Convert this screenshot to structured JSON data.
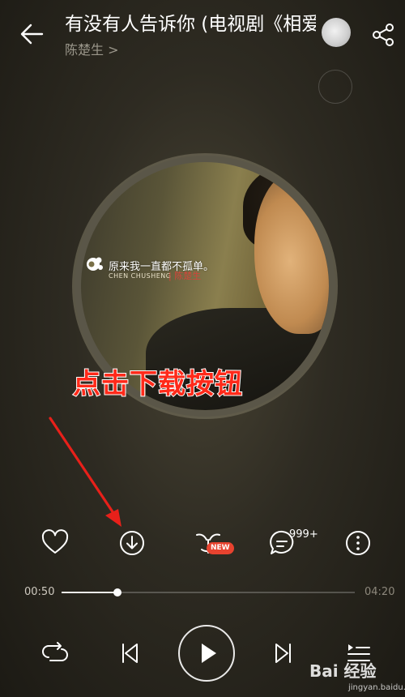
{
  "header": {
    "title": "有没有人告诉你 (电视剧《相爱",
    "artist": "陈楚生 >"
  },
  "cover": {
    "slogan": "原来我一直都不孤单。",
    "sub_text": "CHEN CHUSHENG",
    "sub_text2": "| 陈楚生"
  },
  "annotation": {
    "caption": "点击下载按钮"
  },
  "actions": {
    "items": [
      "heart-icon",
      "download-icon",
      "tone-icon",
      "comment-icon",
      "more-icon"
    ],
    "new_badge": "NEW",
    "comment_count": "999+"
  },
  "progress": {
    "elapsed": "00:50",
    "total": "04:20",
    "fraction": 0.19
  },
  "controls": {
    "items": [
      "repeat-icon",
      "previous-icon",
      "play-icon",
      "next-icon",
      "playlist-icon"
    ]
  },
  "watermark": {
    "brand": "Bai 经验",
    "url": "jingyan.baidu.com"
  }
}
